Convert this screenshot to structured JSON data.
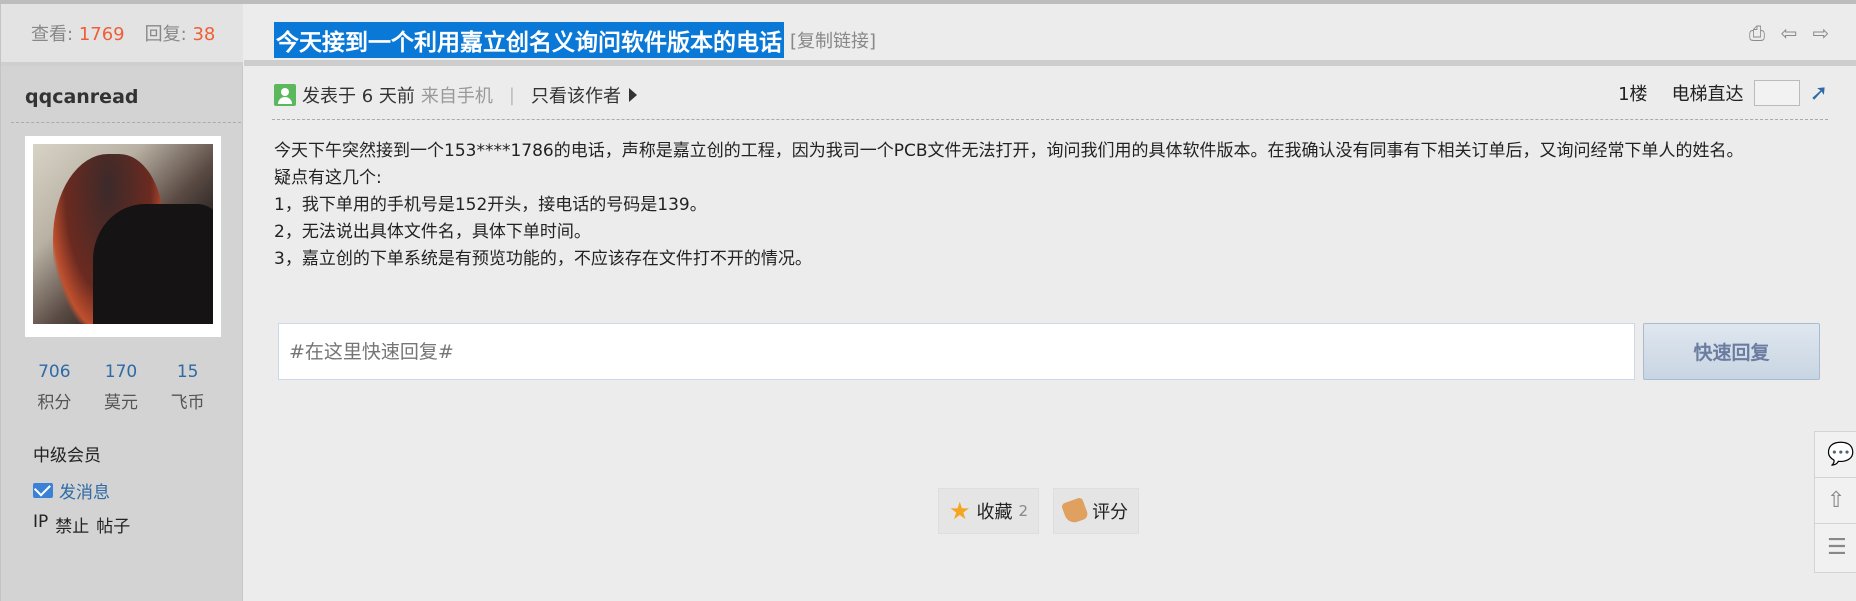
{
  "stats": {
    "views_label": "查看:",
    "views": "1769",
    "replies_label": "回复:",
    "replies": "38"
  },
  "author": {
    "name": "qqcanread",
    "stats": [
      {
        "value": "706",
        "label": "积分"
      },
      {
        "value": "170",
        "label": "莫元"
      },
      {
        "value": "15",
        "label": "飞币"
      }
    ],
    "rank": "中级会员",
    "send_message": "发消息",
    "mod_links": [
      "IP",
      "禁止",
      "帖子"
    ]
  },
  "post": {
    "title": "今天接到一个利用嘉立创名义询问软件版本的电话",
    "copy_link": "[复制链接]",
    "posted_prefix": "发表于 6 天前",
    "posted_via": "来自手机",
    "only_author": "只看该作者",
    "floor": "1楼",
    "jump_label": "电梯直达",
    "content": [
      "今天下午突然接到一个153****1786的电话，声称是嘉立创的工程，因为我司一个PCB文件无法打开，询问我们用的具体软件版本。在我确认没有同事有下相关订单后，又询问经常下单人的姓名。",
      "疑点有这几个:",
      "1，我下单用的手机号是152开头，接电话的号码是139。",
      "2，无法说出具体文件名，具体下单时间。",
      "3，嘉立创的下单系统是有预览功能的，不应该存在文件打不开的情况。"
    ]
  },
  "reply": {
    "placeholder": "#在这里快速回复#",
    "button": "快速回复"
  },
  "actions": {
    "favorite": "收藏",
    "favorite_count": "2",
    "rate": "评分"
  },
  "icons": {
    "print": "printer-icon",
    "prev": "arrow-left-icon",
    "next": "arrow-right-icon",
    "go": "go-icon",
    "chat": "chat-icon",
    "top": "back-to-top-icon",
    "list": "list-icon"
  }
}
